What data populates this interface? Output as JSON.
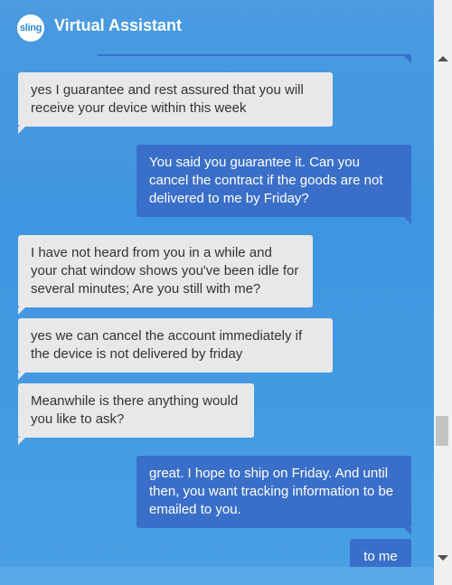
{
  "header": {
    "logo_text": "sling",
    "title": "Virtual Assistant"
  },
  "messages": [
    {
      "sender": "bot",
      "text": "yes I guarantee and rest assured that you will receive your device within this week"
    },
    {
      "sender": "user",
      "text": "You said you guarantee it. Can you cancel the contract if the goods are not delivered to me by Friday?"
    },
    {
      "sender": "bot",
      "text": "I have not heard from you in a while and your chat window shows you've been idle for several minutes; Are you still with me?"
    },
    {
      "sender": "bot",
      "text": "yes we can cancel the account immediately if the device is not delivered by friday"
    },
    {
      "sender": "bot",
      "text": "Meanwhile is there anything would you like to ask?"
    },
    {
      "sender": "user",
      "text": "great. I hope to ship on Friday. And until then, you want tracking information to be emailed to you."
    },
    {
      "sender": "user",
      "text": "to me"
    }
  ],
  "colors": {
    "background": "#4a9be0",
    "bot_bubble": "#e8e8e8",
    "user_bubble": "#3a6fc9"
  }
}
